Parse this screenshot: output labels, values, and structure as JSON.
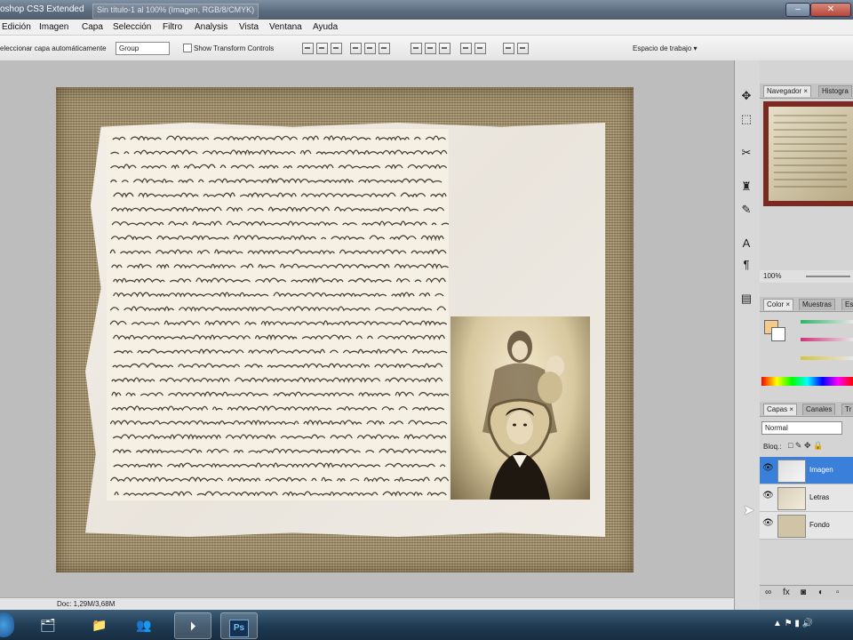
{
  "window": {
    "app_title": "oshop CS3 Extended",
    "doc_title": "Sin título-1 al 100% (Imagen, RGB/8/CMYK)"
  },
  "menu": [
    "Edición",
    "Imagen",
    "Capa",
    "Selección",
    "Filtro",
    "Analysis",
    "Vista",
    "Ventana",
    "Ayuda"
  ],
  "options": {
    "auto_select_label": "eleccionar capa automáticamente",
    "auto_select_value": "Group",
    "transform_label": "Show Transform Controls",
    "workspace_label": "Espacio de trabajo ▾"
  },
  "status": {
    "doc_size": "Doc: 1,29M/3,68M"
  },
  "panels": {
    "navigator_tabs": [
      "Navegador ×",
      "Histogra"
    ],
    "zoom": "100%",
    "color_tabs": [
      "Color ×",
      "Muestras",
      "Es"
    ],
    "layers_tabs": [
      "Capas ×",
      "Canales",
      "Tr"
    ],
    "blend_mode": "Normal",
    "lock_label": "Bloq.:",
    "layers": [
      {
        "name": "Imagen",
        "selected": true
      },
      {
        "name": "Letras",
        "selected": false
      },
      {
        "name": "Fondo",
        "selected": false
      }
    ]
  },
  "colors": {
    "accent_selected_layer": "#3a7fd9",
    "foreground_swatch": "#f3c98e",
    "taskbar": "#1f3a52"
  },
  "icons": {
    "tools": [
      "move-tool-icon",
      "marquee-tool-icon",
      "crop-tool-icon",
      "stamp-tool-icon",
      "brush-tool-icon",
      "text-tool-icon",
      "paragraph-icon",
      "layer-comps-icon"
    ],
    "taskbar": [
      "start-orb-icon",
      "explorer-icon",
      "folder-icon",
      "messenger-icon",
      "media-player-icon",
      "photoshop-icon"
    ]
  },
  "taskbar": {
    "ps_label": "Ps"
  }
}
